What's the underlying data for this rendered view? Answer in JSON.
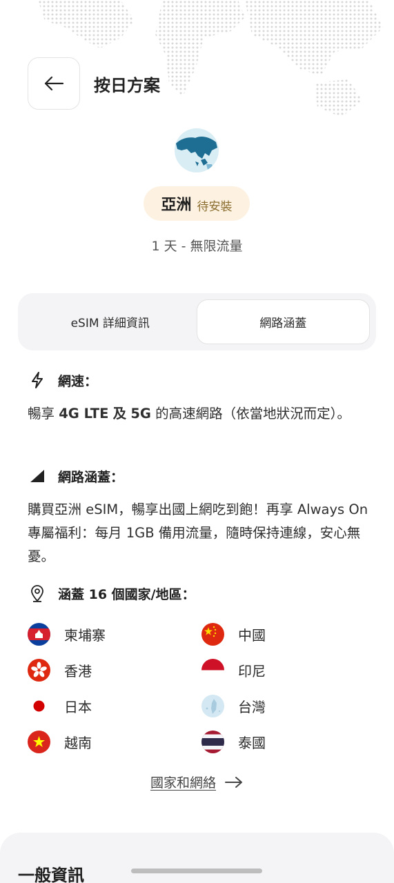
{
  "header": {
    "title": "按日方案"
  },
  "plan": {
    "region": "亞洲",
    "status": "待安裝",
    "description": "1 天 - 無限流量"
  },
  "tabs": [
    {
      "label": "eSIM 詳細資訊",
      "active": false
    },
    {
      "label": "網路涵蓋",
      "active": true
    }
  ],
  "speed": {
    "title": "網速：",
    "text_prefix": "暢享 ",
    "text_bold1": "4G LTE",
    "text_mid1": " ",
    "text_bold2": "及",
    "text_mid2": " ",
    "text_bold3": "5G",
    "text_suffix": " 的高速網路（依當地狀況而定）。"
  },
  "coverage": {
    "title": "網路涵蓋：",
    "text": "購買亞洲 eSIM，暢享出國上網吃到飽！再享 Always On 專屬福利：每月 1GB 備用流量，隨時保持連線，安心無憂。"
  },
  "countries_section": {
    "title": "涵蓋 16 個國家/地區：",
    "items": [
      {
        "name": "柬埔寨",
        "flag": "cambodia-flag"
      },
      {
        "name": "中國",
        "flag": "china-flag"
      },
      {
        "name": "香港",
        "flag": "hongkong-flag"
      },
      {
        "name": "印尼",
        "flag": "indonesia-flag"
      },
      {
        "name": "日本",
        "flag": "japan-flag"
      },
      {
        "name": "台灣",
        "flag": "taiwan-flag"
      },
      {
        "name": "越南",
        "flag": "vietnam-flag"
      },
      {
        "name": "泰國",
        "flag": "thailand-flag"
      }
    ]
  },
  "more_link": {
    "label": "國家和網絡"
  },
  "general": {
    "title": "一般資訊"
  },
  "colors": {
    "pill_bg": "#fdf2e1",
    "status_text": "#8a6d2f",
    "tab_bg": "#f4f4f6"
  }
}
